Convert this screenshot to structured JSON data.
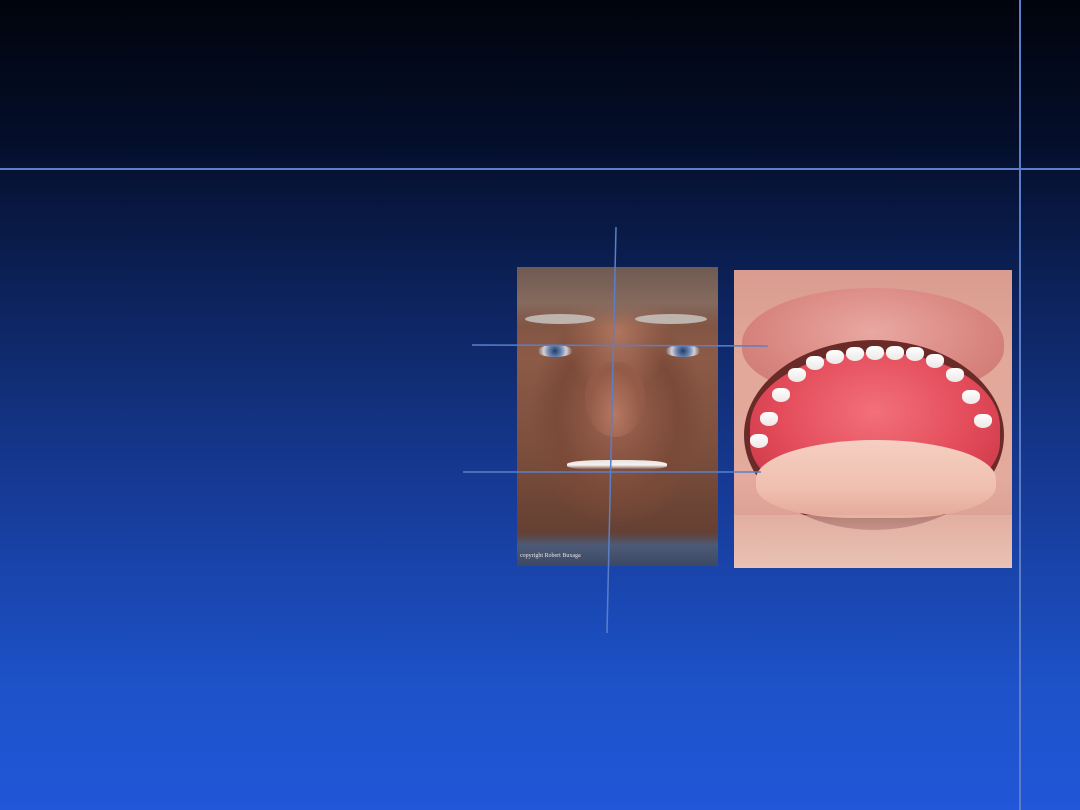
{
  "slide": {
    "background_top": "#01040c",
    "background_bottom": "#2157d8",
    "rule_color": "#5a7fc8"
  },
  "photos": {
    "face": {
      "copyright": "copyright Robert Buxaga"
    },
    "mouth": {}
  },
  "overlay": {
    "line_color": "#5a7fc8",
    "lines": [
      {
        "name": "face-midline-vertical"
      },
      {
        "name": "pupil-line-horizontal"
      },
      {
        "name": "occlusal-line-horizontal"
      }
    ]
  }
}
